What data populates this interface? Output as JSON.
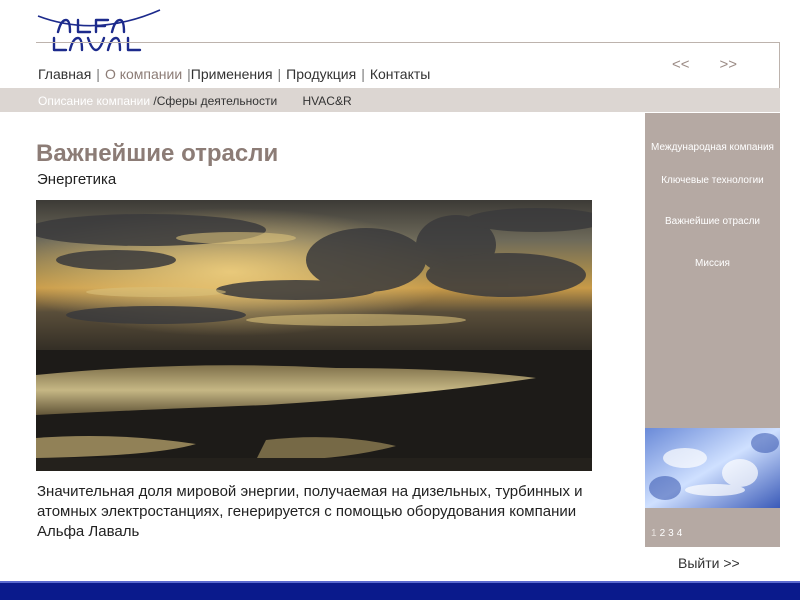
{
  "logo": {
    "text": "ALFA LAVAL"
  },
  "main_nav": {
    "home": "Главная",
    "about": "О компании",
    "applications": "Применения",
    "products": "Продукция",
    "contacts": "Контакты",
    "separator": "|"
  },
  "pager": {
    "prev": "<<",
    "next": ">>"
  },
  "sub_nav": {
    "description": "Описание компании",
    "separator": "/",
    "activities": "Сферы деятельности",
    "hvac": "HVAC&R"
  },
  "content": {
    "title": "Важнейшие отрасли",
    "subtitle": "Энергетика",
    "body": "Значительная доля мировой энергии, получаемая на дизельных, турбинных и атомных электростанциях, генерируется с помощью оборудования компании Альфа Лаваль"
  },
  "side_panel": {
    "items": [
      {
        "label": "Международная компания"
      },
      {
        "label": "Ключевые технологии"
      },
      {
        "label": "Важнейшие отрасли"
      },
      {
        "label": "Миссия"
      }
    ],
    "pages": [
      "1",
      "2",
      "3",
      "4"
    ]
  },
  "footer": {
    "exit": "Выйти >>"
  },
  "colors": {
    "accent": "#8c7c76",
    "side_panel": "#b5a9a3",
    "sub_bar": "#dcd6d2",
    "bottom_bar": "#0a1a8c",
    "logo_blue": "#1c2a8c"
  }
}
